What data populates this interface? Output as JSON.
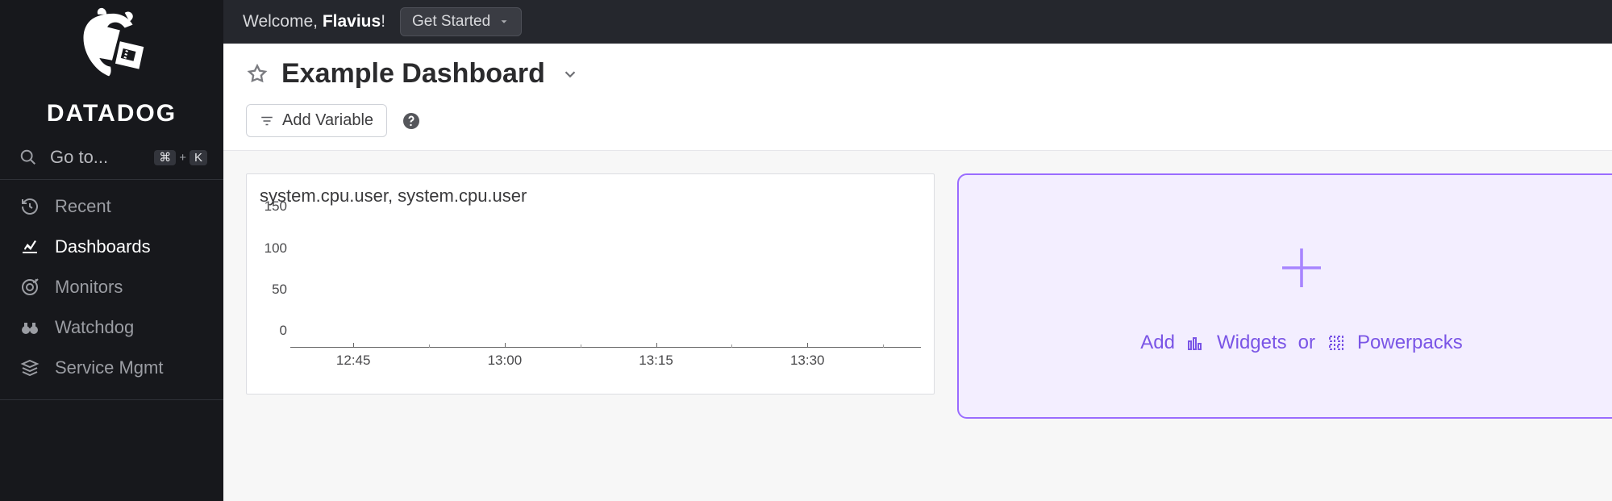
{
  "brand": {
    "name": "DATADOG"
  },
  "sidebar": {
    "search_label": "Go to...",
    "kbd1": "⌘",
    "kbd_plus": "+",
    "kbd2": "K",
    "items": [
      {
        "label": "Recent",
        "active": false,
        "icon": "history"
      },
      {
        "label": "Dashboards",
        "active": true,
        "icon": "dash"
      },
      {
        "label": "Monitors",
        "active": false,
        "icon": "target"
      },
      {
        "label": "Watchdog",
        "active": false,
        "icon": "binoc"
      },
      {
        "label": "Service Mgmt",
        "active": false,
        "icon": "stack"
      }
    ]
  },
  "topbar": {
    "welcome_prefix": "Welcome, ",
    "user_name": "Flavius",
    "welcome_suffix": "!",
    "get_started": "Get Started"
  },
  "header": {
    "title": "Example Dashboard",
    "add_variable": "Add Variable"
  },
  "widget": {
    "title": "system.cpu.user, system.cpu.user"
  },
  "chart_data": {
    "type": "line",
    "title": "system.cpu.user, system.cpu.user",
    "xlabel": "",
    "ylabel": "",
    "ylim": [
      0,
      160
    ],
    "y_ticks": [
      0,
      50,
      100,
      150
    ],
    "x_ticks": [
      "12:45",
      "13:00",
      "13:15",
      "13:30"
    ],
    "series": []
  },
  "add_widget": {
    "add": "Add",
    "widgets": "Widgets",
    "or": "or",
    "powerpacks": "Powerpacks"
  }
}
